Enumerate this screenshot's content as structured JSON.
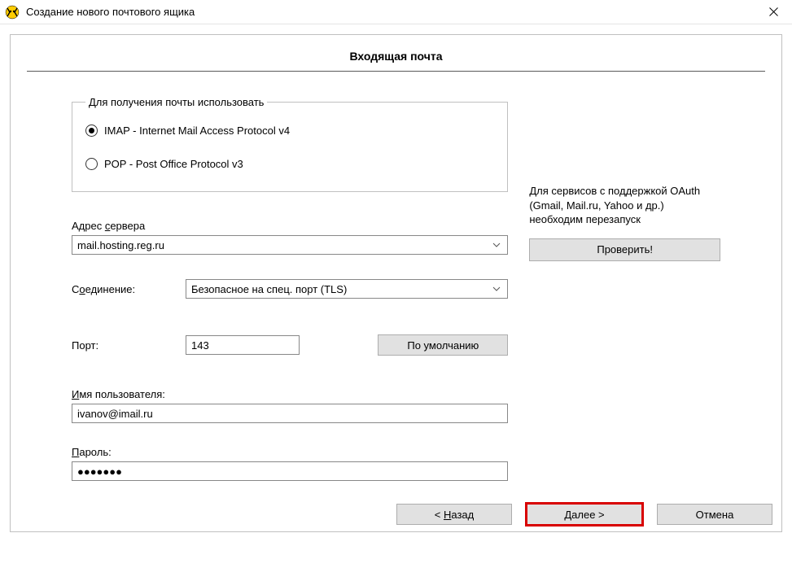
{
  "window": {
    "title": "Создание нового почтового ящика"
  },
  "page": {
    "heading": "Входящая почта"
  },
  "protocol": {
    "legend": "Для получения почты использовать",
    "imap": "IMAP - Internet Mail Access Protocol v4",
    "pop": "POP  -  Post Office Protocol v3",
    "selected": "imap"
  },
  "server": {
    "label_pre": "Адрес ",
    "label_ul": "с",
    "label_post": "ервера",
    "value": "mail.hosting.reg.ru"
  },
  "connection": {
    "label_pre": "С",
    "label_ul": "о",
    "label_post": "единение:",
    "value": "Безопасное на спец. порт (TLS)"
  },
  "port": {
    "label": "Порт:",
    "value": "143",
    "default_btn": "По умолчанию"
  },
  "username": {
    "label_ul": "И",
    "label_post": "мя пользователя:",
    "value": "ivanov@imail.ru"
  },
  "password": {
    "label_ul": "П",
    "label_post": "ароль:",
    "value": "●●●●●●●"
  },
  "oauth_note": "Для сервисов с поддержкой OAuth (Gmail, Mail.ru, Yahoo и др.) необходим перезапуск",
  "check_btn": "Проверить!",
  "footer": {
    "back_pre": "<  ",
    "back_ul": "Н",
    "back_post": "азад",
    "next": "Далее   >",
    "cancel": "Отмена"
  }
}
